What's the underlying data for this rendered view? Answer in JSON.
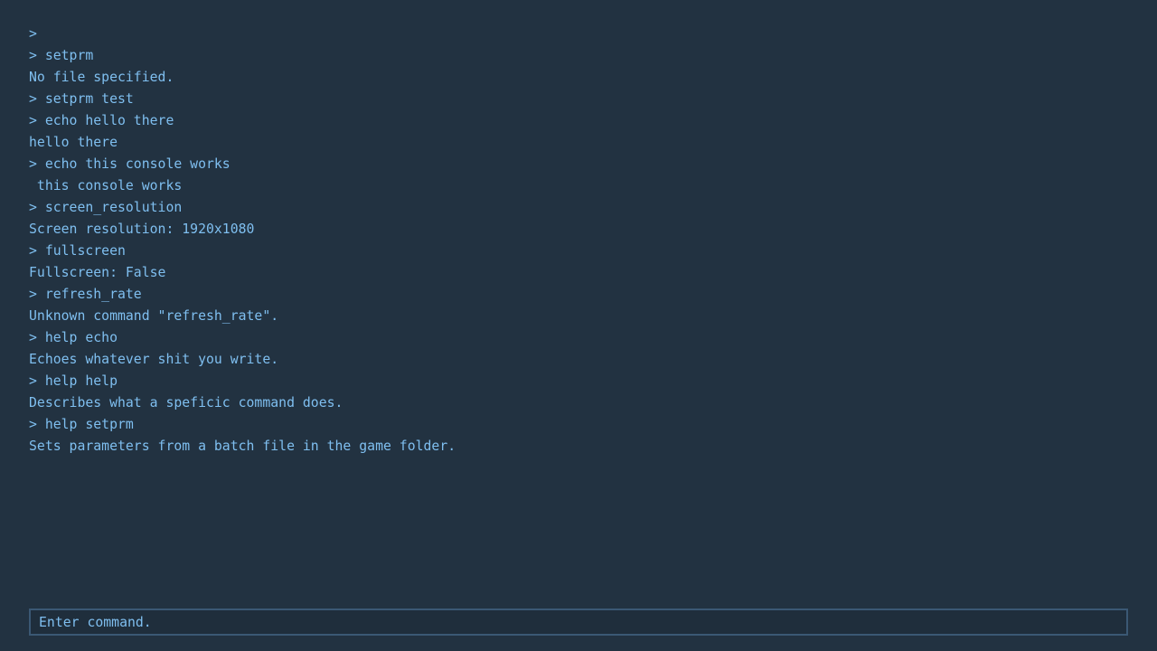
{
  "console": {
    "lines": [
      ">",
      "> setprm",
      "No file specified.",
      "> setprm test",
      "> echo hello there",
      "hello there",
      "> echo this console works",
      " this console works",
      "> screen_resolution",
      "Screen resolution: 1920x1080",
      "> fullscreen",
      "Fullscreen: False",
      "> refresh_rate",
      "Unknown command \"refresh_rate\".",
      "> help echo",
      "Echoes whatever shit you write.",
      "> help help",
      "Describes what a speficic command does.",
      "> help setprm",
      "Sets parameters from a batch file in the game folder."
    ]
  },
  "input": {
    "placeholder": "Enter command.",
    "value": ""
  },
  "colors": {
    "background": "#223241",
    "text": "#7fbff0",
    "input_border": "#3b5874"
  }
}
